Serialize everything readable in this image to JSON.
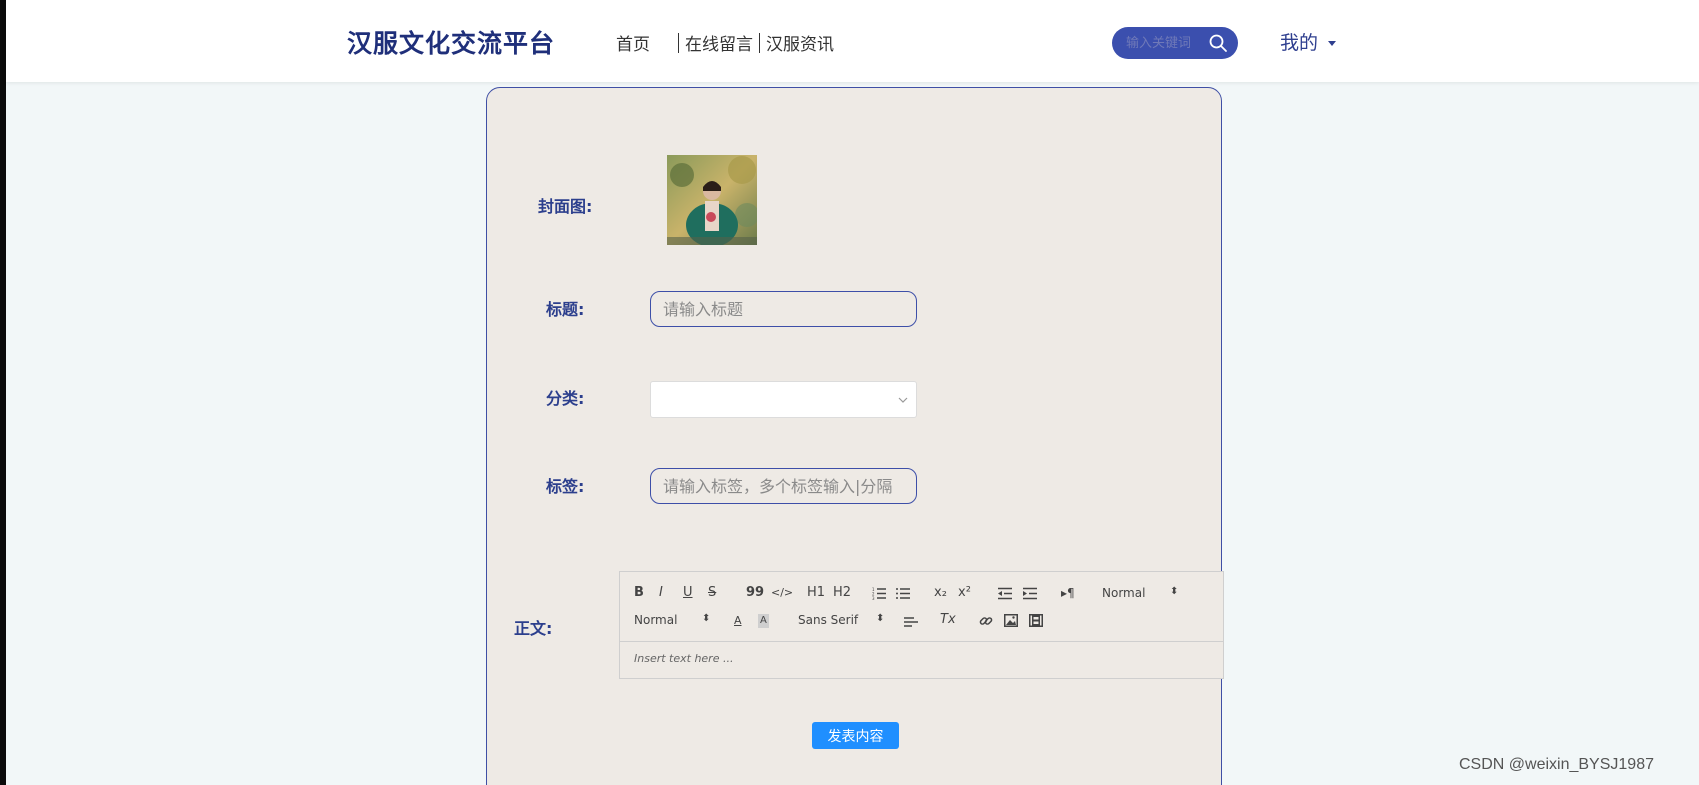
{
  "header": {
    "brand": "汉服文化交流平台",
    "nav": [
      {
        "label": "首页"
      },
      {
        "label": "在线留言"
      },
      {
        "label": "汉服资讯"
      }
    ],
    "search": {
      "placeholder": "输入关键词"
    },
    "user_menu": {
      "label": "我的"
    }
  },
  "form": {
    "cover": {
      "label": "封面图:"
    },
    "title": {
      "label": "标题:",
      "placeholder": "请输入标题",
      "value": ""
    },
    "category": {
      "label": "分类:",
      "value": ""
    },
    "tags": {
      "label": "标签:",
      "placeholder": "请输入标签，多个标签输入|分隔"
    },
    "content": {
      "label": "正文:",
      "toolbar": {
        "bold": "B",
        "italic": "I",
        "underline": "U",
        "strike": "S",
        "quote": "99",
        "code": "</>",
        "h1": "H1",
        "h2": "H2",
        "sub": "x₂",
        "sup": "x²",
        "header_select": "Normal",
        "size_select": "Normal",
        "font_select": "Sans Serif",
        "clean": "Tx"
      },
      "placeholder": "Insert text here ..."
    },
    "submit_label": "发表内容"
  },
  "watermark": "CSDN @weixin_BYSJ1987",
  "colors": {
    "brand": "#1f2f7a",
    "accent": "#3b4fae",
    "button": "#1f8fff",
    "card_bg": "#eeeae5"
  }
}
